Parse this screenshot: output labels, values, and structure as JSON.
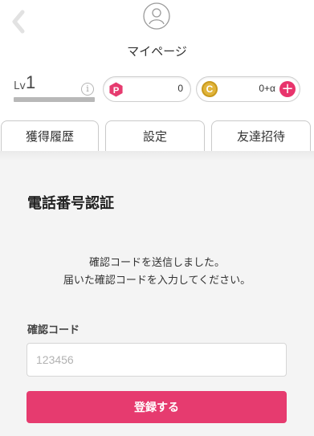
{
  "header": {
    "title": "マイページ",
    "back_icon": "chevron-left-icon",
    "avatar_icon": "user-icon"
  },
  "level": {
    "prefix": "Lv",
    "value": "1",
    "progress": 1.0,
    "info_icon": "i"
  },
  "points": {
    "p_label": "P",
    "p_value": "0",
    "c_label": "C",
    "c_value": "0+α",
    "add_label": "+"
  },
  "tabs": [
    {
      "label": "獲得履歴",
      "active": false
    },
    {
      "label": "設定",
      "active": true
    },
    {
      "label": "友達招待",
      "active": false
    }
  ],
  "verify": {
    "title": "電話番号認証",
    "message_line1": "確認コードを送信しました。",
    "message_line2": "届いた確認コードを入力してください。",
    "field_label": "確認コード",
    "input_placeholder": "123456",
    "input_value": "",
    "submit_label": "登録する"
  },
  "colors": {
    "accent": "#e63b6f",
    "coin": "#e1b43a",
    "background": "#f4f4f4"
  }
}
